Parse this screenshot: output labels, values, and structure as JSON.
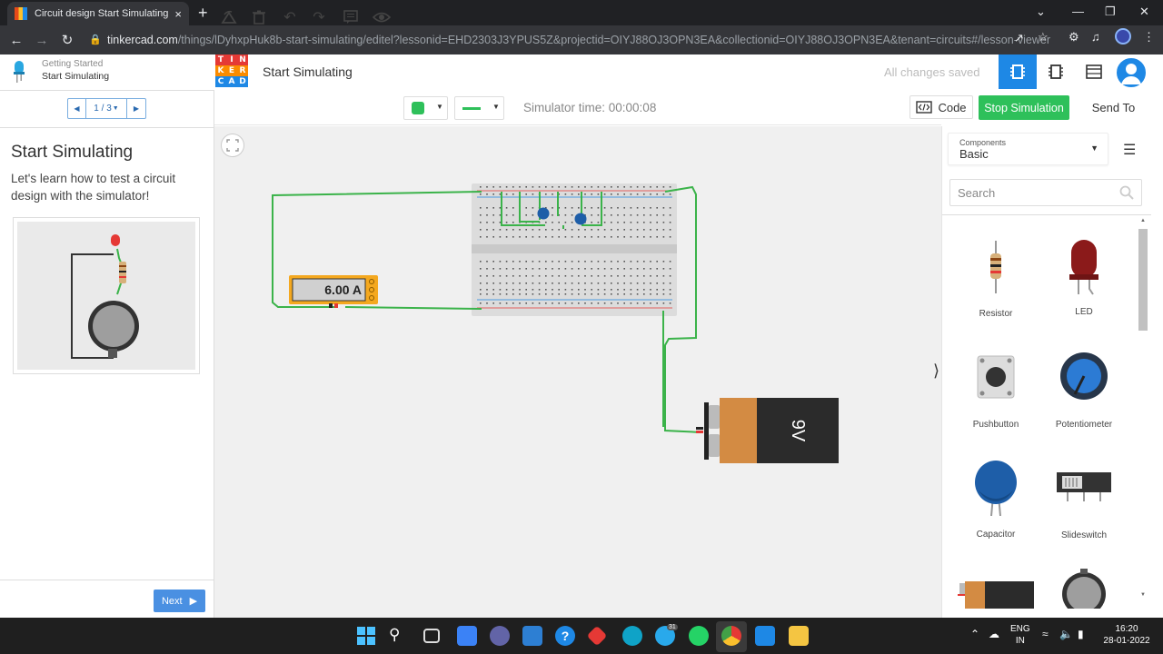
{
  "browser": {
    "tab_title": "Circuit design Start Simulating | T",
    "tab_close": "×",
    "new_tab": "+",
    "url_domain": "tinkercad.com",
    "url_path": "/things/lDyhxpHuk8b-start-simulating/editel?lessonid=EHD2303J3YPUS5Z&projectid=OIYJ88OJ3OPN3EA&collectionid=OIYJ88OJ3OPN3EA&tenant=circuits#/lesson-viewer"
  },
  "lesson_header": {
    "section": "Getting Started",
    "lesson": "Start Simulating"
  },
  "app": {
    "logo_letters": [
      "T",
      "I",
      "N",
      "K",
      "E",
      "R",
      "C",
      "A",
      "D"
    ],
    "logo_colors": [
      "#e53935",
      "#e53935",
      "#e53935",
      "#fb8c00",
      "#fb8c00",
      "#fb8c00",
      "#1e88e5",
      "#1e88e5",
      "#1e88e5"
    ],
    "title": "Start Simulating",
    "save_status": "All changes saved"
  },
  "lesson": {
    "pager": "1 / 3",
    "title": "Start Simulating",
    "description": "Let's learn how to test a circuit design with the simulator!",
    "next_label": "Next"
  },
  "editor": {
    "sim_time": "Simulator time: 00:00:08",
    "code_label": "Code",
    "stop_label": "Stop Simulation",
    "send_label": "Send To",
    "multimeter_reading": "6.00 A",
    "battery_label": "9V",
    "accent_green": "#2ec05a",
    "accent_blue": "#1e88e5"
  },
  "components_panel": {
    "heading": "Components",
    "selected": "Basic",
    "search_placeholder": "Search",
    "items": [
      {
        "name": "Resistor"
      },
      {
        "name": "LED"
      },
      {
        "name": "Pushbutton"
      },
      {
        "name": "Potentiometer"
      },
      {
        "name": "Capacitor"
      },
      {
        "name": "Slideswitch"
      }
    ]
  },
  "taskbar": {
    "lang_top": "ENG",
    "lang_bottom": "IN",
    "time": "16:20",
    "date": "28-01-2022",
    "telegram_badge": "31"
  }
}
